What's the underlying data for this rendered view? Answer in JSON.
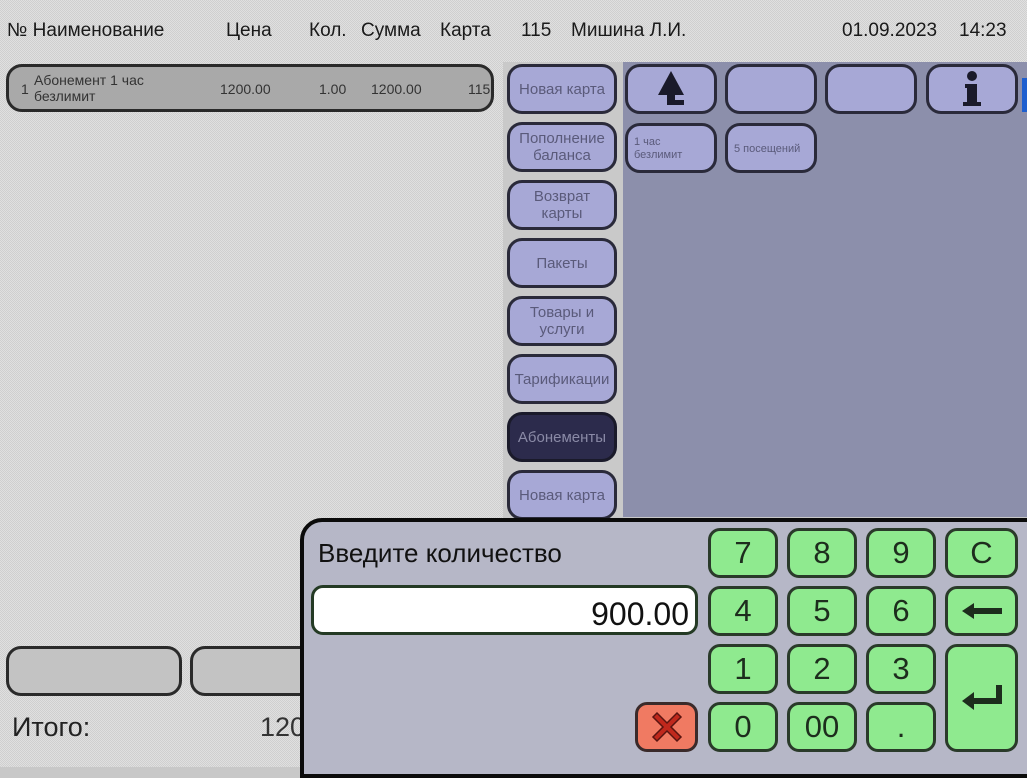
{
  "header": {
    "col_num_name": "№ Наименование",
    "col_price": "Цена",
    "col_qty": "Кол.",
    "col_sum": "Сумма",
    "col_card": "Карта",
    "terminal": "115",
    "cashier": "Мишина Л.И.",
    "date": "01.09.2023",
    "time": "14:23"
  },
  "order": {
    "rows": [
      {
        "num": "1",
        "name_line1": "Абонемент 1 час",
        "name_line2": "безлимит",
        "price": "1200.00",
        "qty": "1.00",
        "sum": "1200.00",
        "card": "115"
      }
    ],
    "total_label": "Итого:",
    "total_value": "120"
  },
  "categories": [
    {
      "label_line1": "Новая карта",
      "label_line2": ""
    },
    {
      "label_line1": "Пополнение",
      "label_line2": "баланса"
    },
    {
      "label_line1": "Возврат",
      "label_line2": "карты"
    },
    {
      "label_line1": "Пакеты",
      "label_line2": ""
    },
    {
      "label_line1": "Товары и",
      "label_line2": "услуги"
    },
    {
      "label_line1": "Тарификации",
      "label_line2": ""
    },
    {
      "label_line1": "Абонементы",
      "label_line2": "",
      "active": true
    },
    {
      "label_line1": "Новая карта",
      "label_line2": ""
    }
  ],
  "nav": {
    "up_icon": "arrow-up-icon",
    "info_icon": "info-icon"
  },
  "products": [
    {
      "line1": "1 час",
      "line2": "безлимит"
    },
    {
      "line1": "5 посещений",
      "line2": ""
    }
  ],
  "qty_dialog": {
    "title": "Введите количество",
    "value": "900.00",
    "keys": {
      "k7": "7",
      "k8": "8",
      "k9": "9",
      "clear": "C",
      "k4": "4",
      "k5": "5",
      "k6": "6",
      "k1": "1",
      "k2": "2",
      "k3": "3",
      "k0": "0",
      "k00": "00",
      "dot": "."
    },
    "backspace_icon": "backspace-arrow-icon",
    "enter_icon": "enter-return-icon",
    "cancel_icon": "close-x-icon"
  },
  "colors": {
    "category_button": "#a7a8d6",
    "category_active": "#2c2b4c",
    "product_area": "#8c8fab",
    "keypad_key": "#8fea8f",
    "cancel_key": "#f07a62",
    "dialog_bg": "#b6b7c7"
  }
}
